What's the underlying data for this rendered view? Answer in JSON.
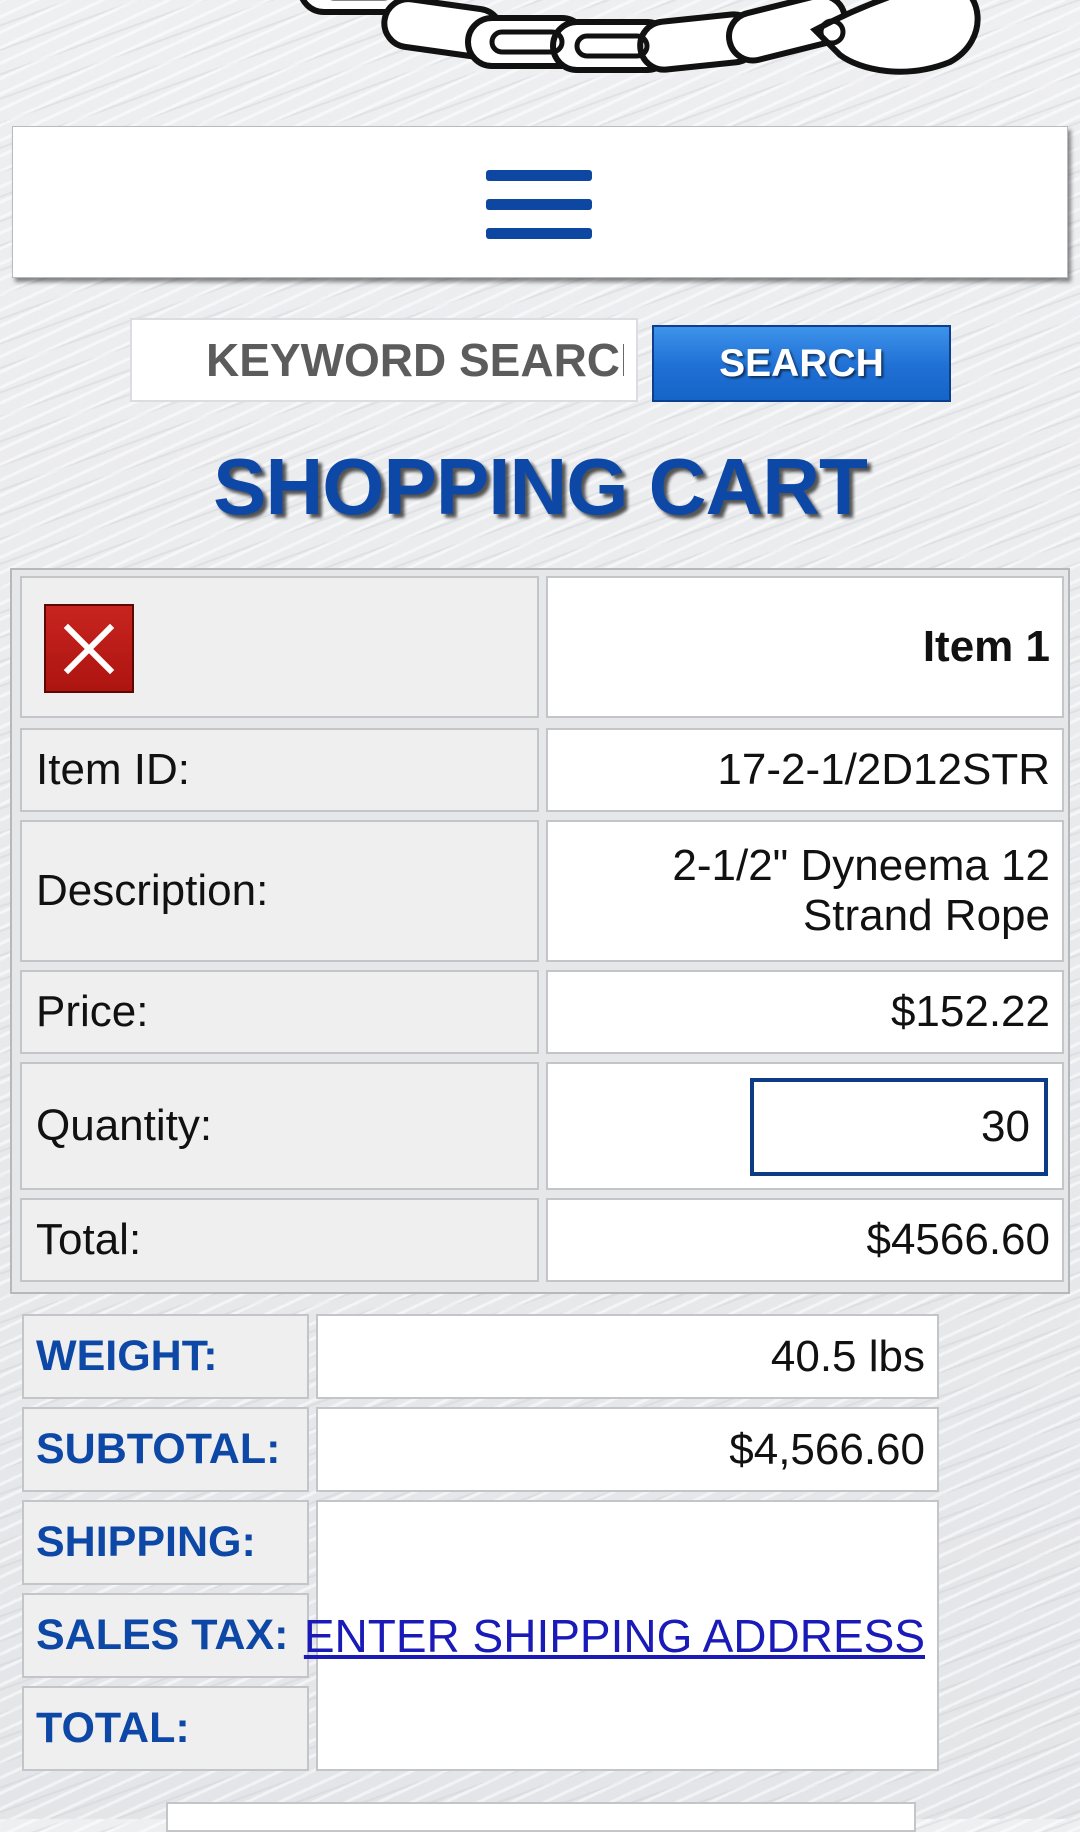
{
  "header": {
    "logo_icon": "chain-and-hook-logo",
    "menu_icon": "hamburger-menu-icon"
  },
  "search": {
    "placeholder": "KEYWORD SEARCH",
    "button_label": "SEARCH"
  },
  "page": {
    "title": "SHOPPING CART"
  },
  "cart": {
    "items": [
      {
        "heading": "Item 1",
        "remove_icon": "close-x-icon",
        "fields": [
          {
            "label": "Item ID:",
            "value": "17-2-1/2D12STR"
          },
          {
            "label": "Description:",
            "value": "2-1/2\" Dyneema 12 Strand Rope"
          },
          {
            "label": "Price:",
            "value": "$152.22"
          },
          {
            "label": "Quantity:",
            "value": "30"
          },
          {
            "label": "Total:",
            "value": "$4566.60"
          }
        ]
      }
    ]
  },
  "summary": {
    "weight_label": "WEIGHT:",
    "weight_value": "40.5 lbs",
    "subtotal_label": "SUBTOTAL:",
    "subtotal_value": "$4,566.60",
    "shipping_label": "SHIPPING:",
    "sales_tax_label": "SALES TAX:",
    "total_label": "TOTAL:",
    "shipping_link": "ENTER SHIPPING ADDRESS"
  },
  "colors": {
    "brand_blue": "#0d48a6",
    "search_button": "#1f6fd4",
    "remove_red": "#c8241f",
    "link_blue": "#1a1ab8"
  }
}
